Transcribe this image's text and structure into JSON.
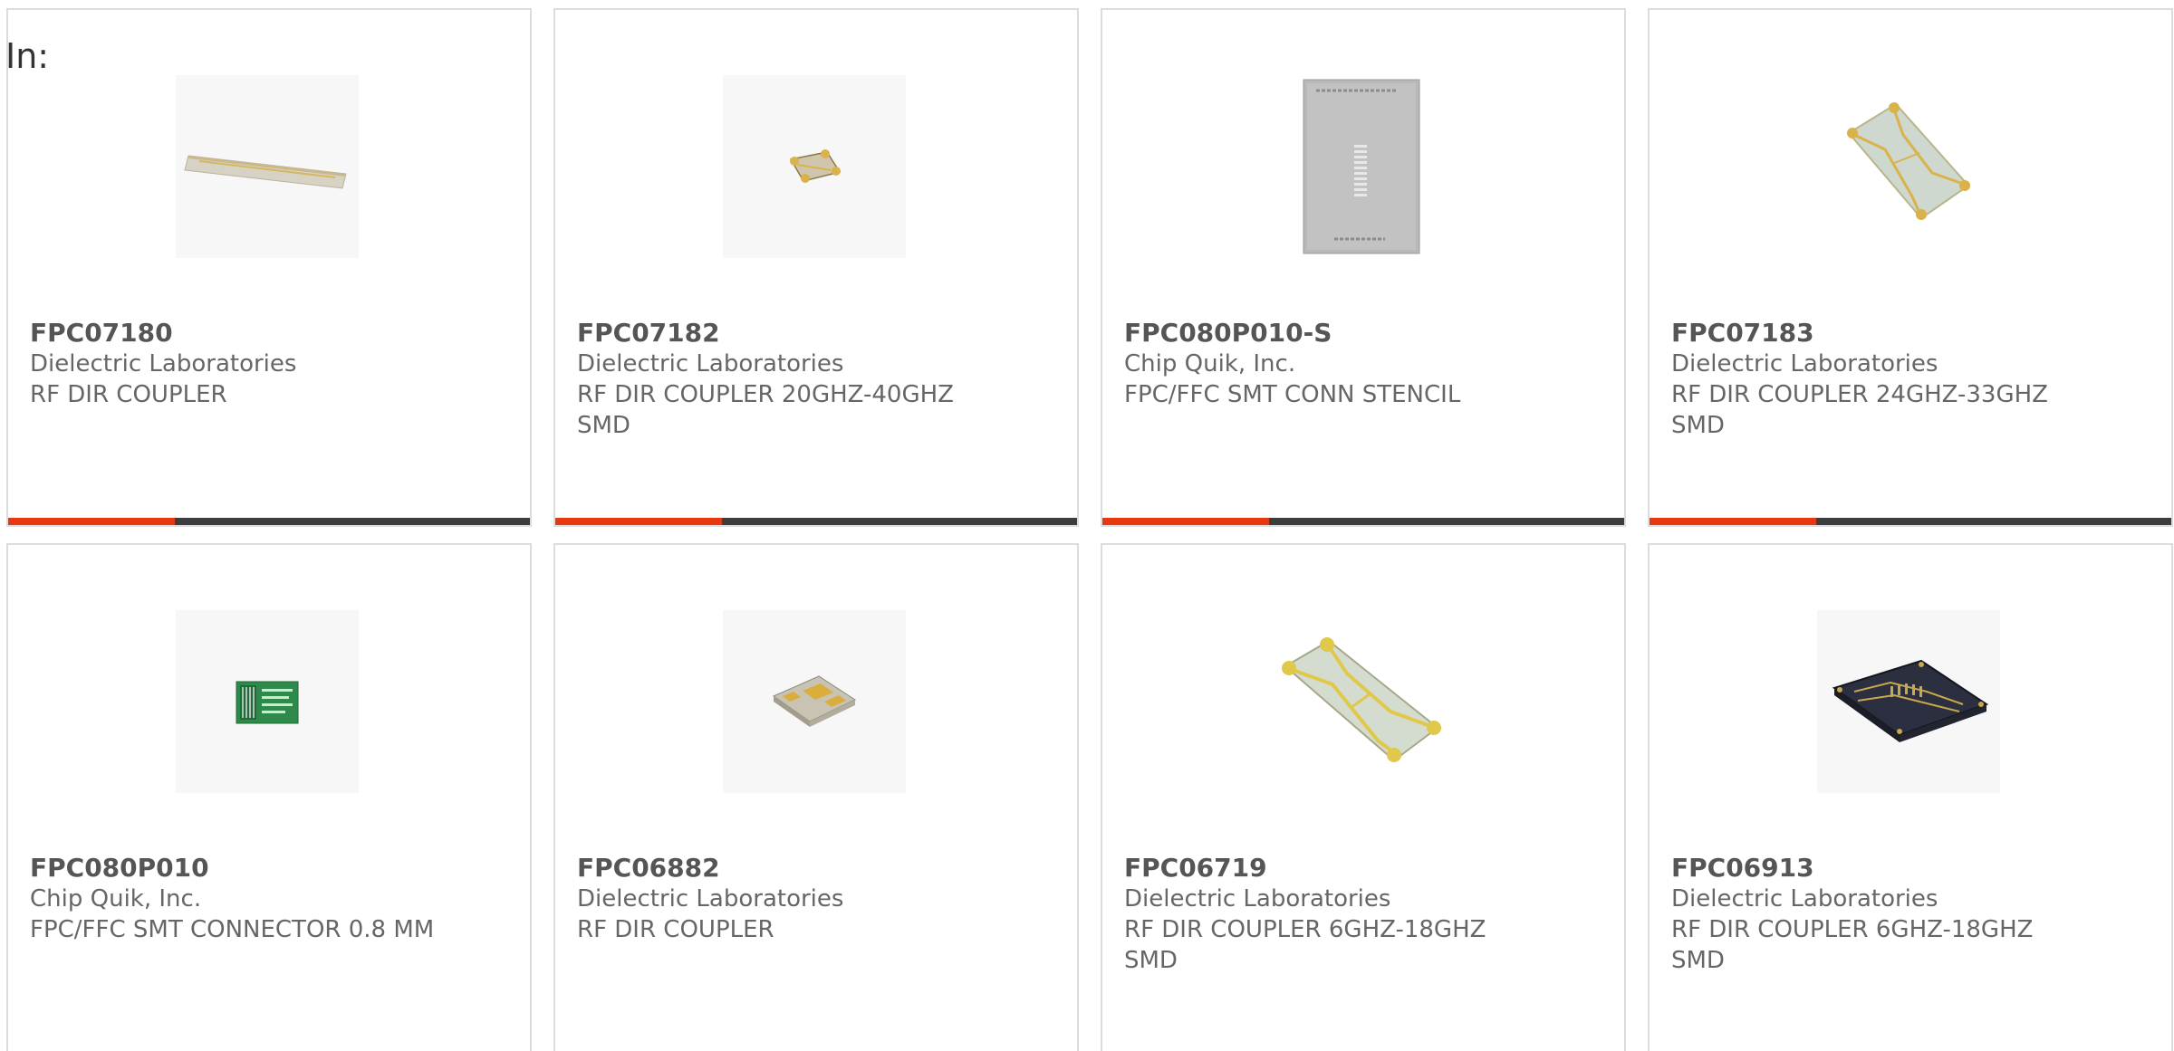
{
  "prefix_label": "In:",
  "colors": {
    "accent": "#e8380d",
    "bar_track": "#3d3d3d",
    "card_border": "#dcdcdc",
    "text": "#666666"
  },
  "products": [
    {
      "part_number": "FPC07180",
      "manufacturer": "Dielectric Laboratories",
      "description": "RF DIR COUPLER",
      "image_icon": "long-strip-coupler-icon",
      "progress": 0.32
    },
    {
      "part_number": "FPC07182",
      "manufacturer": "Dielectric Laboratories",
      "description": "RF DIR COUPLER 20GHZ-40GHZ SMD",
      "image_icon": "small-chip-coupler-icon",
      "progress": 0.32
    },
    {
      "part_number": "FPC080P010-S",
      "manufacturer": "Chip Quik, Inc.",
      "description": "FPC/FFC SMT CONN STENCIL",
      "image_icon": "stencil-sheet-icon",
      "progress": 0.32
    },
    {
      "part_number": "FPC07183",
      "manufacturer": "Dielectric Laboratories",
      "description": "RF DIR COUPLER 24GHZ-33GHZ SMD",
      "image_icon": "tilted-coupler-icon",
      "progress": 0.32
    },
    {
      "part_number": "FPC080P010",
      "manufacturer": "Chip Quik, Inc.",
      "description": "FPC/FFC SMT CONNECTOR 0.8 MM",
      "image_icon": "green-pcb-adapter-icon"
    },
    {
      "part_number": "FPC06882",
      "manufacturer": "Dielectric Laboratories",
      "description": "RF DIR COUPLER",
      "image_icon": "gold-pad-chip-icon"
    },
    {
      "part_number": "FPC06719",
      "manufacturer": "Dielectric Laboratories",
      "description": "RF DIR COUPLER 6GHZ-18GHZ SMD",
      "image_icon": "tilted-coupler-large-icon"
    },
    {
      "part_number": "FPC06913",
      "manufacturer": "Dielectric Laboratories",
      "description": "RF DIR COUPLER 6GHZ-18GHZ SMD",
      "image_icon": "dark-coupler-icon"
    }
  ]
}
